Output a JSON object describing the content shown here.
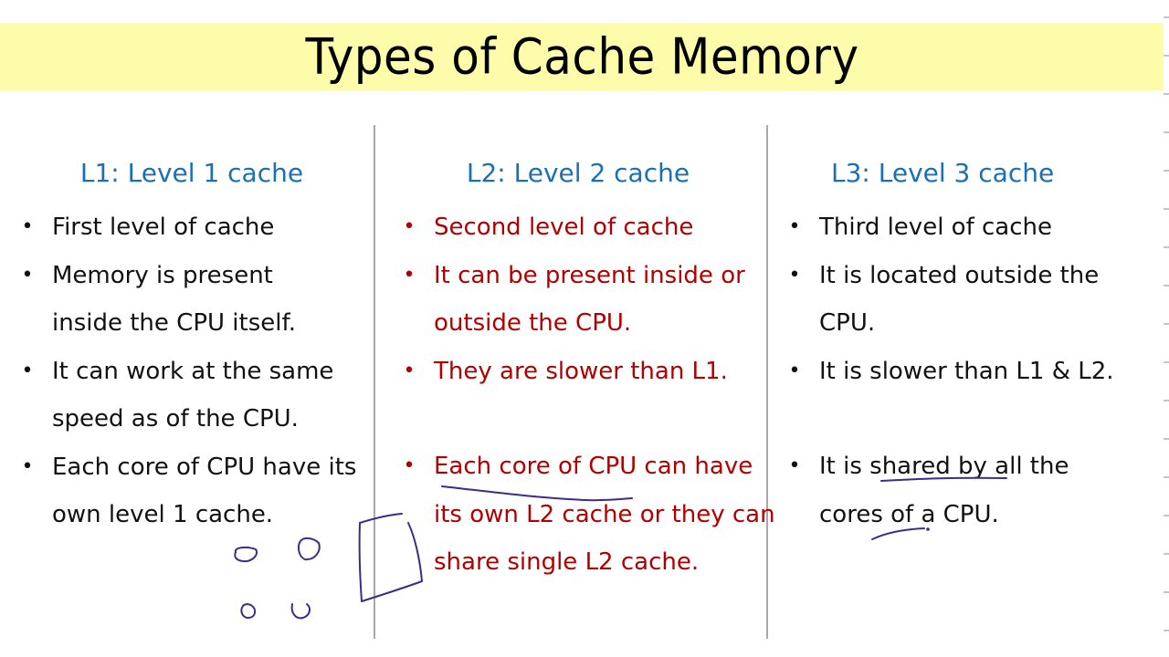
{
  "slide": {
    "title": "Types of Cache Memory",
    "colors": {
      "title_band": "#fdfcaa",
      "heading": "#1a6fb5",
      "l1_text": "#111111",
      "l2_text": "#b00000",
      "l3_text": "#111111",
      "pen_annotation": "#3f2a8a"
    },
    "columns": [
      {
        "heading": "L1: Level 1 cache",
        "items": [
          "First level of cache",
          "Memory is present inside the CPU itself.",
          "It can work at the same speed as of the CPU.",
          "Each core of CPU have its own level 1 cache."
        ]
      },
      {
        "heading": "L2: Level 2 cache",
        "items": [
          "Second level of cache",
          "It can be present inside or outside the CPU.",
          "They are slower than L1.",
          "Each core of CPU can have its own L2 cache or they can share single L2 cache."
        ]
      },
      {
        "heading": "L3: Level 3 cache",
        "items": [
          "Third level of cache",
          "It is located outside the CPU.",
          "It is slower than L1 & L2.",
          "It is shared by all the cores of a CPU."
        ]
      }
    ],
    "bullet_glyph": "•"
  }
}
